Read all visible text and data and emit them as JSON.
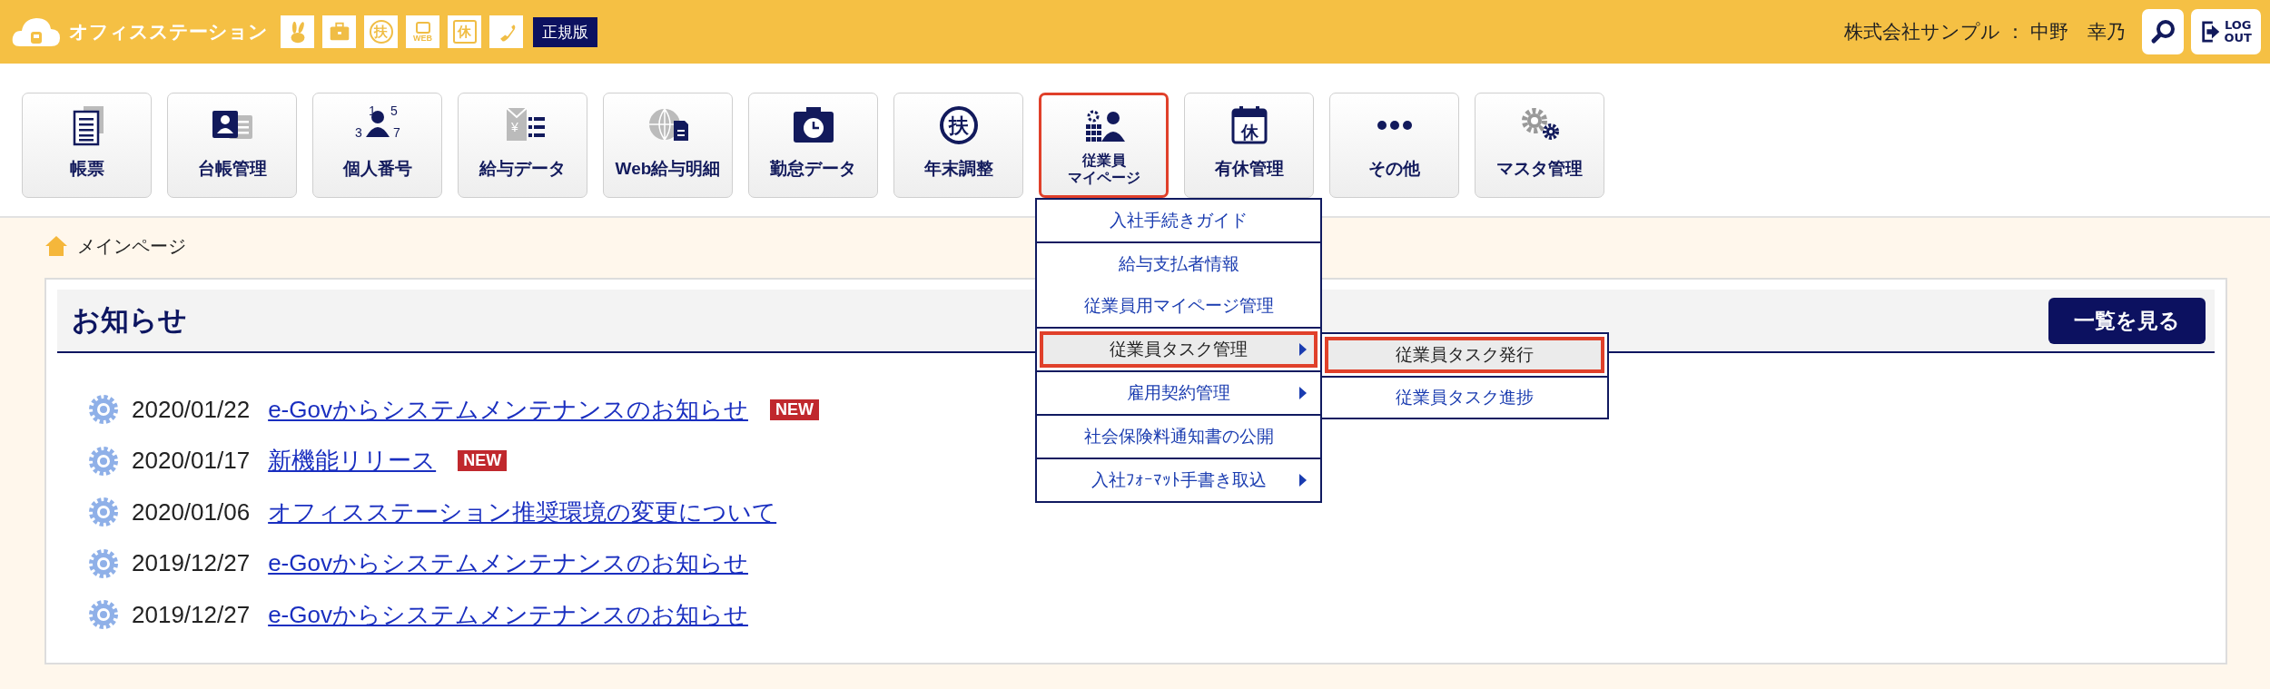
{
  "header": {
    "app_name": "オフィスステーション",
    "shortcut_icons": [
      {
        "kind": "rabbit"
      },
      {
        "kind": "briefcase"
      },
      {
        "kind": "seal",
        "text": "扶"
      },
      {
        "kind": "web",
        "text": "WEB"
      },
      {
        "kind": "stamp",
        "text": "休"
      },
      {
        "kind": "phone"
      }
    ],
    "edition_badge": "正規版",
    "user": "株式会社サンプル ： 中野　幸乃",
    "logout_label": [
      "LOG",
      "OUT"
    ]
  },
  "nav": [
    {
      "kind": "forms",
      "label": [
        "帳票"
      ],
      "selected": false
    },
    {
      "kind": "ledger",
      "label": [
        "台帳管理"
      ],
      "selected": false
    },
    {
      "kind": "mynumber",
      "label": [
        "個人番号"
      ],
      "icon_text": [
        "1",
        "5",
        "3",
        "7"
      ],
      "selected": false
    },
    {
      "kind": "payroll",
      "label": [
        "給与データ"
      ],
      "icon_text": [
        "¥"
      ],
      "selected": false
    },
    {
      "kind": "webpay",
      "label": [
        "Web給与明細"
      ],
      "selected": false
    },
    {
      "kind": "attendance",
      "label": [
        "勤怠データ"
      ],
      "selected": false
    },
    {
      "kind": "yearend",
      "label": [
        "年末調整"
      ],
      "icon_text": [
        "扶"
      ],
      "selected": false
    },
    {
      "kind": "employee",
      "label": [
        "従業員",
        "マイページ"
      ],
      "selected": true
    },
    {
      "kind": "leave",
      "label": [
        "有休管理"
      ],
      "icon_text": [
        "休"
      ],
      "selected": false
    },
    {
      "kind": "more",
      "label": [
        "その他"
      ],
      "selected": false
    },
    {
      "kind": "master",
      "label": [
        "マスタ管理"
      ],
      "selected": false
    }
  ],
  "menu": {
    "groups": [
      {
        "items": [
          {
            "label": "入社手続きガイド",
            "has_submenu": false,
            "selected": false
          }
        ]
      },
      {
        "items": [
          {
            "label": "給与支払者情報",
            "has_submenu": false,
            "selected": false
          },
          {
            "label": "従業員用マイページ管理",
            "has_submenu": false,
            "selected": false
          }
        ]
      },
      {
        "items": [
          {
            "label": "従業員タスク管理",
            "has_submenu": true,
            "selected": true
          }
        ]
      },
      {
        "items": [
          {
            "label": "雇用契約管理",
            "has_submenu": true,
            "selected": false
          }
        ]
      },
      {
        "items": [
          {
            "label": "社会保険料通知書の公開",
            "has_submenu": false,
            "selected": false
          }
        ]
      },
      {
        "items": [
          {
            "label": "入社ﾌｫｰﾏｯﾄ手書き取込",
            "has_submenu": true,
            "selected": false
          }
        ]
      }
    ],
    "submenu": [
      {
        "label": "従業員タスク発行",
        "selected": true
      },
      {
        "label": "従業員タスク進捗",
        "selected": false
      }
    ]
  },
  "breadcrumb": "メインページ",
  "notices": {
    "title": "お知らせ",
    "view_all": "一覧を見る",
    "items": [
      {
        "date": "2020/01/22",
        "title": "e-Govからシステムメンテナンスのお知らせ",
        "badge": "NEW"
      },
      {
        "date": "2020/01/17",
        "title": "新機能リリース",
        "badge": "NEW"
      },
      {
        "date": "2020/01/06",
        "title": "オフィスステーション推奨環境の変更について"
      },
      {
        "date": "2019/12/27",
        "title": "e-Govからシステムメンテナンスのお知らせ"
      },
      {
        "date": "2019/12/27",
        "title": "e-Govからシステムメンテナンスのお知らせ"
      }
    ]
  }
}
